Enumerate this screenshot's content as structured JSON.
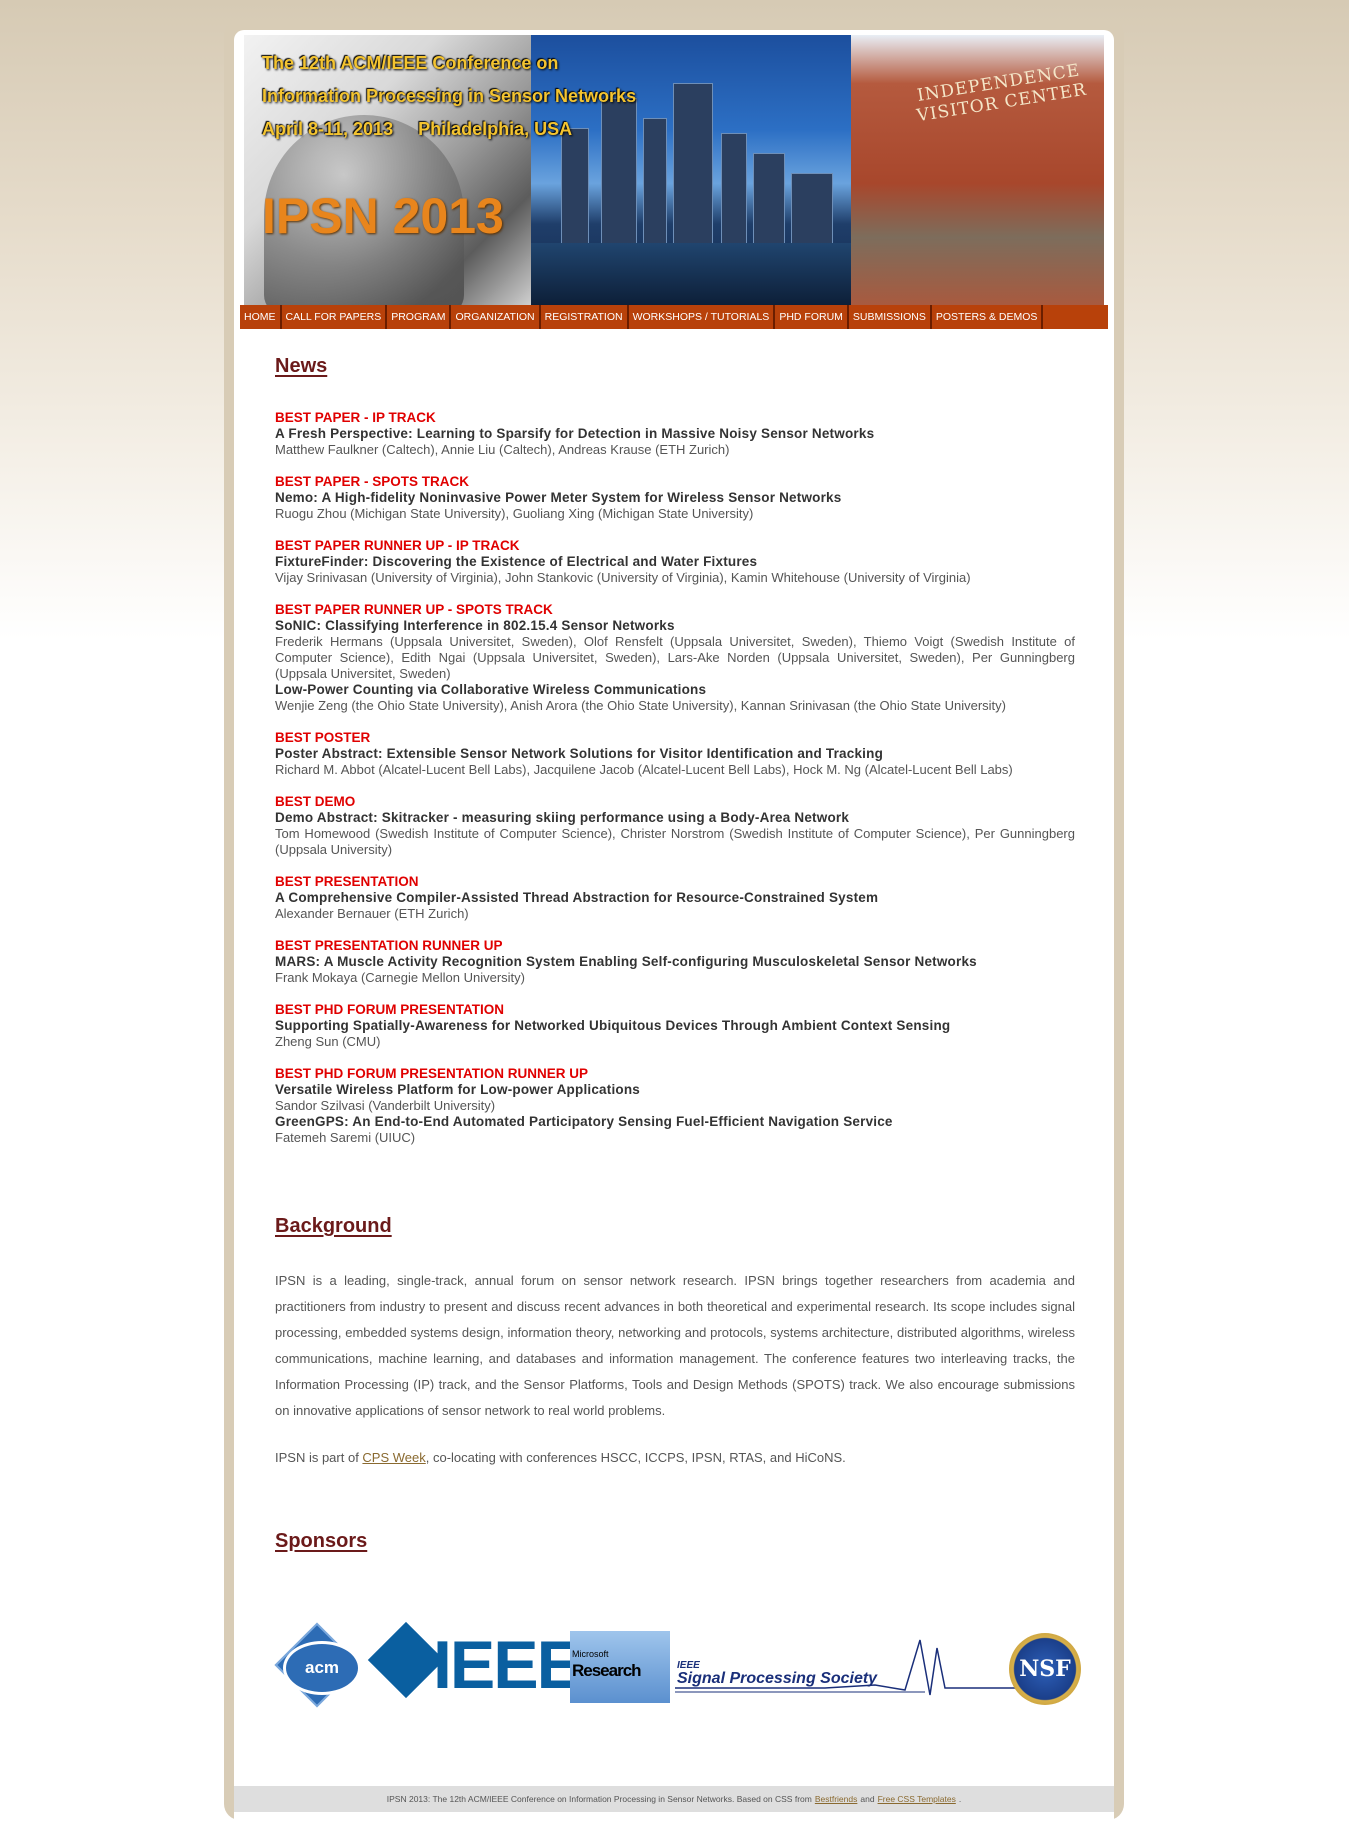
{
  "header": {
    "line1": "The 12th ACM/IEEE Conference on",
    "line2": "Information Processing in Sensor Networks",
    "line3": "April 8-11, 2013     Philadelphia, USA",
    "logo": "IPSN 2013",
    "visitor_center_sign": "INDEPENDENCE VISITOR CENTER"
  },
  "nav": [
    "HOME",
    "CALL FOR PAPERS",
    "PROGRAM",
    "ORGANIZATION",
    "REGISTRATION",
    "WORKSHOPS / TUTORIALS",
    "PHD FORUM",
    "SUBMISSIONS",
    "POSTERS & DEMOS"
  ],
  "news": {
    "heading": "News",
    "awards": [
      {
        "award": "BEST PAPER - IP TRACK",
        "papers": [
          {
            "title": "A Fresh Perspective: Learning to Sparsify for Detection in Massive Noisy Sensor Networks",
            "authors": "Matthew Faulkner (Caltech), Annie Liu (Caltech), Andreas Krause (ETH Zurich)"
          }
        ]
      },
      {
        "award": "BEST PAPER - SPOTS TRACK",
        "papers": [
          {
            "title": "Nemo: A High-fidelity Noninvasive Power Meter System for Wireless Sensor Networks",
            "authors": "Ruogu Zhou (Michigan State University), Guoliang Xing (Michigan State University)"
          }
        ]
      },
      {
        "award": "BEST PAPER RUNNER UP - IP TRACK",
        "papers": [
          {
            "title": "FixtureFinder: Discovering the Existence of Electrical and Water Fixtures",
            "authors": "Vijay Srinivasan (University of Virginia), John Stankovic (University of Virginia), Kamin Whitehouse (University of Virginia)"
          }
        ]
      },
      {
        "award": "BEST PAPER RUNNER UP - SPOTS TRACK",
        "papers": [
          {
            "title": "SoNIC: Classifying Interference in 802.15.4 Sensor Networks",
            "authors": "Frederik Hermans (Uppsala Universitet, Sweden), Olof Rensfelt (Uppsala Universitet, Sweden), Thiemo Voigt (Swedish Institute of Computer Science), Edith Ngai (Uppsala Universitet, Sweden), Lars-Ake Norden (Uppsala Universitet, Sweden), Per Gunningberg (Uppsala Universitet, Sweden)"
          },
          {
            "title": "Low-Power Counting via Collaborative Wireless Communications",
            "authors": "Wenjie Zeng (the Ohio State University), Anish Arora (the Ohio State University), Kannan Srinivasan (the Ohio State University)"
          }
        ]
      },
      {
        "award": "BEST POSTER",
        "papers": [
          {
            "title": "Poster Abstract: Extensible Sensor Network Solutions for Visitor Identification and Tracking",
            "authors": "Richard M. Abbot (Alcatel-Lucent Bell Labs), Jacquilene Jacob (Alcatel-Lucent Bell Labs), Hock M. Ng (Alcatel-Lucent Bell Labs)"
          }
        ]
      },
      {
        "award": "BEST DEMO",
        "papers": [
          {
            "title": "Demo Abstract: Skitracker - measuring skiing performance using a Body-Area Network",
            "authors": "Tom Homewood (Swedish Institute of Computer Science), Christer Norstrom (Swedish Institute of Computer Science), Per Gunningberg (Uppsala University)"
          }
        ]
      },
      {
        "award": "BEST PRESENTATION",
        "papers": [
          {
            "title": "A Comprehensive Compiler-Assisted Thread Abstraction for Resource-Constrained System",
            "authors": "Alexander Bernauer (ETH Zurich)"
          }
        ]
      },
      {
        "award": "BEST PRESENTATION RUNNER UP",
        "papers": [
          {
            "title": "MARS: A Muscle Activity Recognition System Enabling Self-configuring Musculoskeletal Sensor Networks",
            "authors": "Frank Mokaya (Carnegie Mellon University)"
          }
        ]
      },
      {
        "award": "BEST PHD FORUM PRESENTATION",
        "papers": [
          {
            "title": "Supporting Spatially-Awareness for Networked Ubiquitous Devices Through Ambient Context Sensing",
            "authors": "Zheng Sun (CMU)"
          }
        ]
      },
      {
        "award": "BEST PHD FORUM PRESENTATION RUNNER UP",
        "papers": [
          {
            "title": "Versatile Wireless Platform for Low-power Applications",
            "authors": "Sandor Szilvasi (Vanderbilt University)"
          },
          {
            "title": "GreenGPS: An End-to-End Automated Participatory Sensing Fuel-Efficient Navigation Service",
            "authors": "Fatemeh Saremi (UIUC)"
          }
        ]
      }
    ]
  },
  "background": {
    "heading": "Background",
    "paragraph": "IPSN is a leading, single-track, annual forum on sensor network research. IPSN brings together researchers from academia and practitioners from industry to present and discuss recent advances in both theoretical and experimental research. Its scope includes signal processing, embedded systems design, information theory, networking and protocols, systems architecture, distributed algorithms, wireless communications, machine learning, and databases and information management. The conference features two interleaving tracks, the Information Processing (IP) track, and the Sensor Platforms, Tools and Design Methods (SPOTS) track. We also encourage submissions on innovative applications of sensor network to real world problems.",
    "cps_prefix": "IPSN is part of ",
    "cps_link": "CPS Week",
    "cps_suffix": ", co-locating with conferences HSCC, ICCPS, IPSN, RTAS, and HiCoNS."
  },
  "sponsors": {
    "heading": "Sponsors",
    "acm": "acm",
    "ieee": "IEEE",
    "msr_small": "Microsoft",
    "msr_big": "Research",
    "sps_small": "IEEE",
    "sps": "Signal Processing Society",
    "nsf": "NSF"
  },
  "footer": {
    "text": "IPSN 2013: The 12th ACM/IEEE Conference on Information Processing in Sensor Networks. Based on CSS from",
    "link1": "Bestfriends",
    "and": "and",
    "link2": "Free CSS Templates",
    "end": "."
  },
  "colors": {
    "nav_bg": "#b8410a",
    "award_red": "#e00000",
    "heading": "#6b1a1a",
    "logo_orange": "#e8851c"
  }
}
